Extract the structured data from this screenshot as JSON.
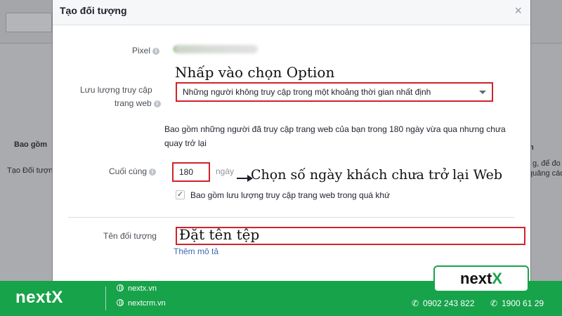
{
  "background": {
    "left_heading": "Bao gồm",
    "left_text": "Tạo Đối tượng",
    "right_heading": "n",
    "right_text_1": "g, để đo",
    "right_text_2": "quảng cáo"
  },
  "modal": {
    "title": "Tạo đối tượng",
    "close_label": "×",
    "pixel_label": "Pixel",
    "traffic_label_1": "Lưu lượng truy cập",
    "traffic_label_2": "trang web",
    "traffic_value": "Những người không truy cập trong một khoảng thời gian nhất định",
    "description": "Bao gồm những người đã truy cập trang web của bạn trong 180 ngày vừa qua nhưng chưa quay trở lại",
    "last_label": "Cuối cùng",
    "days_value": "180",
    "days_unit": "ngày",
    "checkbox_label": "Bao gồm lưu lượng truy cập trang web trong quá khứ",
    "checkbox_mark": "✓",
    "audience_name_label": "Tên đối tượng",
    "audience_name_value": "",
    "add_description": "Thêm mô tả",
    "info_glyph": "i"
  },
  "annotations": {
    "click_option": "Nhấp vào chọn Option",
    "choose_days": "Chọn số ngày khách chưa trở lại Web",
    "name_file": "Đặt tên tệp"
  },
  "footer": {
    "brand": "nextX",
    "site_1": "nextx.vn",
    "site_2": "nextcrm.vn",
    "phone_1": "0902 243 822",
    "phone_2": "1900 61 29",
    "logo_prefix": "next",
    "logo_suffix": "X"
  },
  "colors": {
    "highlight_red": "#d1222a",
    "brand_green": "#17a34a",
    "link_blue": "#4267b2"
  },
  "icons": [
    "info-icon",
    "close-icon",
    "caret-down-icon",
    "checkbox-icon",
    "globe-icon",
    "phone-icon",
    "arrow-right-icon"
  ]
}
